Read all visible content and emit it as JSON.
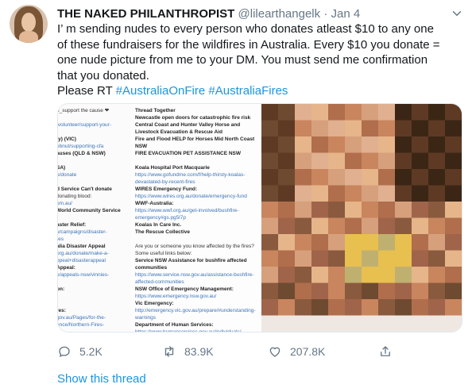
{
  "tweet": {
    "display_name": "THE NAKED PHILANTHROPIST",
    "handle": "@lilearthangelk",
    "date": "Jan 4",
    "lines": [
      "I’  m sending nudes to every person who donates atleast $10 to any one",
      "of these fundraisers for the wildfires in Australia. Every $10 you donate =",
      "one nude picture from me to your DM. You must send me confirmation",
      "that you donated."
    ],
    "please_rt": "Please RT",
    "hashtag1": "#AustraliaOnFire",
    "hashtag2": "#AustraliaFires"
  },
  "media": {
    "left_column": [
      {
        "t": "n_support the cause ❤",
        "s": "n"
      },
      {
        "t": "",
        "s": "n"
      },
      {
        "t": "/volunteer/support-your-",
        "s": "l"
      },
      {
        "t": "",
        "s": "n"
      },
      {
        "t": "ty) (VIC)",
        "s": "b"
      },
      {
        "t": "ebnut/supporting-cfa",
        "s": "l"
      },
      {
        "t": "auses (QLD & NSW)",
        "s": "b"
      },
      {
        "t": "",
        "s": "n"
      },
      {
        "t": "SA)",
        "s": "b"
      },
      {
        "t": "u/donate",
        "s": "l"
      },
      {
        "t": "",
        "s": "n"
      },
      {
        "t": "d Service Can't donate",
        "s": "b"
      },
      {
        "t": "donating blood:",
        "s": "n"
      },
      {
        "t": "om.au/",
        "s": "l"
      },
      {
        "t": "World Community Service",
        "s": "b"
      },
      {
        "t": "",
        "s": "n"
      },
      {
        "t": "aster Relief:",
        "s": "b"
      },
      {
        "t": "u/campaigns/disaster-",
        "s": "l"
      },
      {
        "t": "res",
        "s": "l"
      },
      {
        "t": "alia Disaster Appeal",
        "s": "b"
      },
      {
        "t": "org.au/donate/make-a-",
        "s": "l"
      },
      {
        "t": "ppeal+disasterappeal",
        "s": "l"
      },
      {
        "t": "Appeal:",
        "s": "b"
      },
      {
        "t": "u/appeals-nsw/vinnies-",
        "s": "l"
      },
      {
        "t": "",
        "s": "n"
      },
      {
        "t": "on:",
        "s": "b"
      },
      {
        "t": "",
        "s": "n"
      },
      {
        "t": "",
        "s": "n"
      },
      {
        "t": "res:",
        "s": "b"
      },
      {
        "t": "gov.au/Pages/for-the-",
        "s": "l"
      },
      {
        "t": "ence/Northern-Fires-",
        "s": "l"
      }
    ],
    "mid_column": [
      {
        "t": "Thread Together",
        "s": "b"
      },
      {
        "t": "Newcastle open doors for catastrophic fire risk",
        "s": "b"
      },
      {
        "t": "Central Coast and Hunter Valley Horse and",
        "s": "b"
      },
      {
        "t": "Livestock Evacuation & Rescue Aid",
        "s": "b"
      },
      {
        "t": "Fire and Flood HELP for Horses Mid North Coast",
        "s": "b"
      },
      {
        "t": "NSW",
        "s": "b"
      },
      {
        "t": "FIRE EVACUATION PET ASSISTANCE NSW",
        "s": "b"
      },
      {
        "t": "",
        "s": "n"
      },
      {
        "t": "Koala Hospital Port Macquarie",
        "s": "b"
      },
      {
        "t": "https://www.gofundme.com/f/help-thirsty-koalas-",
        "s": "l"
      },
      {
        "t": "devastated-by-recent-fires",
        "s": "l"
      },
      {
        "t": "WIRES Emergency Fund:",
        "s": "b"
      },
      {
        "t": "https://www.wires.org.au/donate/emergency-fund",
        "s": "l"
      },
      {
        "t": "WWF-Australia:",
        "s": "b"
      },
      {
        "t": "https://www.wwf.org.au/get-involved/bushfire-",
        "s": "l"
      },
      {
        "t": "emergency#gs.pg5l7p",
        "s": "l"
      },
      {
        "t": "Koalas In Care Inc.",
        "s": "b"
      },
      {
        "t": "The Rescue Collective",
        "s": "b"
      },
      {
        "t": "",
        "s": "n"
      },
      {
        "t": "Are you or someone you know affected by the fires?",
        "s": "n"
      },
      {
        "t": "Some useful links below:",
        "s": "n"
      },
      {
        "t": "Service NSW Assistance for bushfire affected",
        "s": "b"
      },
      {
        "t": "communities",
        "s": "b"
      },
      {
        "t": "https://www.service.nsw.gov.au/assistance-bushfire-",
        "s": "l"
      },
      {
        "t": "affected-communities",
        "s": "l"
      },
      {
        "t": "NSW Office of Emergency Management:",
        "s": "b"
      },
      {
        "t": "https://www.emergency.nsw.gov.au/",
        "s": "l"
      },
      {
        "t": "Vic Emergency:",
        "s": "b"
      },
      {
        "t": "http://emergency.vic.gov.au/prepare/#understanding-",
        "s": "l"
      },
      {
        "t": "warnings",
        "s": "l"
      },
      {
        "t": "Department of Human Services:",
        "s": "b"
      },
      {
        "t": "https://www.humanservices.gov.au/individuals/",
        "s": "l"
      },
      {
        "t": "centrelink",
        "s": "l"
      }
    ],
    "pixel_palette": [
      "#c9855e",
      "#b06e4c",
      "#8a5a3e",
      "#5e3a24",
      "#3b2616",
      "#d7a07c",
      "#e0b090",
      "#c0b070",
      "#e8c050",
      "#d9a35c",
      "#efe8e2",
      "#a0644a",
      "#6e4a30",
      "#e6b58a"
    ]
  },
  "actions": {
    "reply_count": "5.2K",
    "retweet_count": "83.9K",
    "like_count": "207.8K"
  },
  "show_thread": "Show this thread",
  "colors": {
    "link": "#1b95e0",
    "muted": "#657786",
    "border": "#e1e8ed"
  }
}
